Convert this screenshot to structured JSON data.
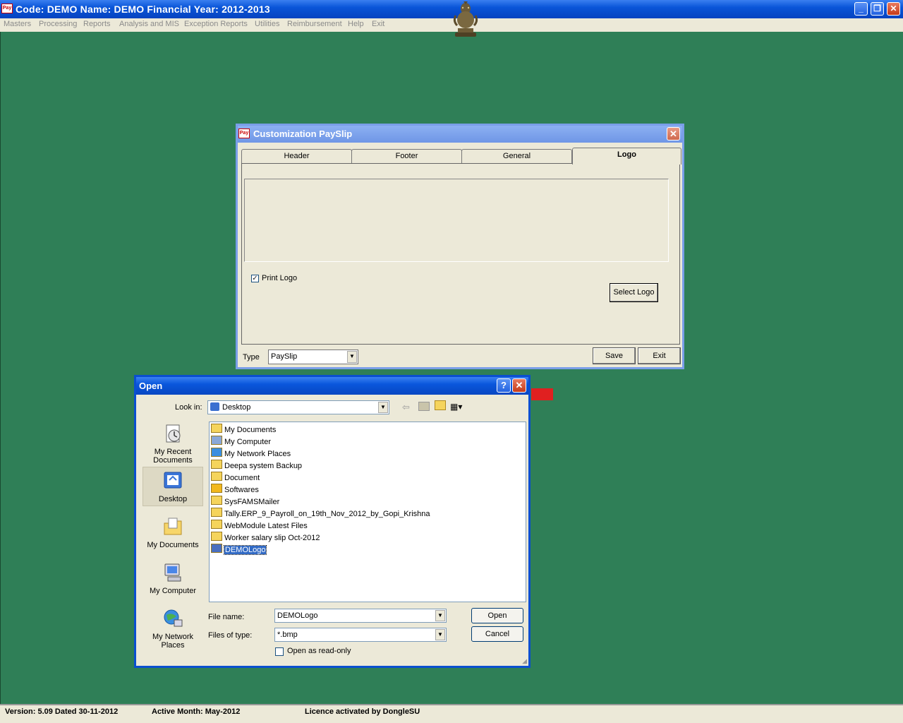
{
  "app": {
    "title": "Code: DEMO Name: DEMO Financial Year: 2012-2013",
    "icon_text": "Pay"
  },
  "menu": [
    "Masters",
    "Processing",
    "Reports",
    "Analysis and MIS",
    "Exception Reports",
    "Utilities",
    "Reimbursement",
    "Help",
    "Exit"
  ],
  "status": {
    "version": "Version: 5.09 Dated 30-11-2012",
    "active_month": "Active Month: May-2012",
    "licence": "Licence activated by DongleSU"
  },
  "customization": {
    "title": "Customization PaySlip",
    "tabs": [
      "Header",
      "Footer",
      "General",
      "Logo"
    ],
    "active_tab": "Logo",
    "print_logo_label": "Print Logo",
    "print_logo_checked": true,
    "select_logo_label": "Select Logo",
    "type_label": "Type",
    "type_value": "PaySlip",
    "save_label": "Save",
    "exit_label": "Exit"
  },
  "open_dialog": {
    "title": "Open",
    "look_in_label": "Look in:",
    "look_in_value": "Desktop",
    "places": [
      {
        "label": "My Recent Documents",
        "icon": "recent-documents-icon"
      },
      {
        "label": "Desktop",
        "icon": "desktop-icon"
      },
      {
        "label": "My Documents",
        "icon": "my-documents-icon"
      },
      {
        "label": "My Computer",
        "icon": "my-computer-icon"
      },
      {
        "label": "My Network Places",
        "icon": "network-places-icon"
      }
    ],
    "files": [
      {
        "name": "My Documents",
        "icon": "my-documents-icon"
      },
      {
        "name": "My Computer",
        "icon": "my-computer-icon"
      },
      {
        "name": "My Network Places",
        "icon": "network-places-icon"
      },
      {
        "name": "Deepa system Backup",
        "icon": "folder-icon"
      },
      {
        "name": "Document",
        "icon": "folder-icon"
      },
      {
        "name": "Softwares",
        "icon": "star-folder-icon"
      },
      {
        "name": "SysFAMSMailer",
        "icon": "folder-icon"
      },
      {
        "name": "Tally.ERP_9_Payroll_on_19th_Nov_2012_by_Gopi_Krishna",
        "icon": "folder-icon"
      },
      {
        "name": "WebModule Latest Files",
        "icon": "folder-icon"
      },
      {
        "name": "Worker salary slip Oct-2012",
        "icon": "folder-icon"
      },
      {
        "name": "DEMOLogo",
        "icon": "bitmap-icon",
        "selected": true
      }
    ],
    "file_name_label": "File name:",
    "file_name_value": "DEMOLogo",
    "file_type_label": "Files of type:",
    "file_type_value": "*.bmp",
    "read_only_label": "Open as read-only",
    "open_label": "Open",
    "cancel_label": "Cancel"
  },
  "colors": {
    "desktop": "#2f7f57",
    "xp_blue": "#0a55d8",
    "dialog_face": "#ece9d8"
  }
}
